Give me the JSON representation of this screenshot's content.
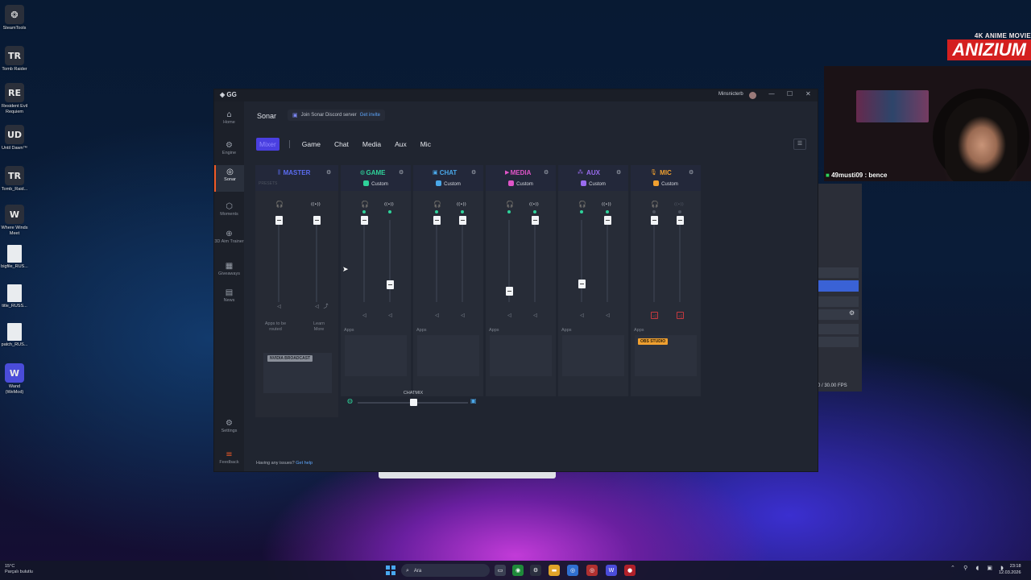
{
  "desktop": {
    "icons": [
      {
        "label": "SteamTools",
        "glyph": "❂"
      },
      {
        "label": "Tomb Raider",
        "glyph": "TR"
      },
      {
        "label": "Resident Evil Requiem",
        "glyph": "RE"
      },
      {
        "label": "Until Dawn™",
        "glyph": "UD"
      },
      {
        "label": "Tomb_Raid...",
        "glyph": "TR"
      },
      {
        "label": "Where Winds Meet",
        "glyph": "W"
      },
      {
        "label": "bigfile_RUS...",
        "glyph": ""
      },
      {
        "label": "title_RUSS...",
        "glyph": ""
      },
      {
        "label": "patch_RUS...",
        "glyph": ""
      },
      {
        "label": "Wand (WeMod)",
        "glyph": "W"
      }
    ]
  },
  "overlay": {
    "brand_top": "4K ANIME MOVIE",
    "brand_logo": "ANIZIUM",
    "chat_user": "49musti09",
    "chat_text": ": bence",
    "obs_fps": "0 / 30.00 FPS"
  },
  "window": {
    "app_logo": "GG",
    "user": "Minsnicterb",
    "controls": {
      "minimize": "—",
      "maximize": "☐",
      "close": "✕"
    }
  },
  "sidebar": {
    "items": [
      {
        "label": "Home",
        "icon": "home-icon",
        "glyph": "⌂"
      },
      {
        "label": "Engine",
        "icon": "engine-icon",
        "glyph": "⚙"
      },
      {
        "label": "Sonar",
        "icon": "sonar-icon",
        "glyph": "◎"
      },
      {
        "label": "Moments",
        "icon": "moments-icon",
        "glyph": "⬡"
      },
      {
        "label": "3D Aim Trainer",
        "icon": "aim-icon",
        "glyph": "⊕"
      },
      {
        "label": "Giveaways",
        "icon": "gift-icon",
        "glyph": "▦"
      },
      {
        "label": "News",
        "icon": "news-icon",
        "glyph": "▤"
      }
    ],
    "settings": "Settings",
    "feedback": "Feedback"
  },
  "header": {
    "title": "Sonar",
    "discord_text": "Join Sonar Discord server",
    "discord_link": "Get invite"
  },
  "tabs": [
    "Mixer",
    "Game",
    "Chat",
    "Media",
    "Aux",
    "Mic"
  ],
  "channels": {
    "master": {
      "name": "MASTER",
      "color": "#5b6cf0",
      "presets": "PRESETS",
      "note_apps": "Apps to be routed",
      "note_learn": "Learn More",
      "app": "NVIDIA BROADCAST",
      "levels": [
        1.0,
        1.0
      ]
    },
    "game": {
      "name": "GAME",
      "color": "#2fd29a",
      "preset": "Custom",
      "apps": "Apps",
      "levels": [
        1.0,
        0.22
      ]
    },
    "chat": {
      "name": "CHAT",
      "color": "#4aa7e8",
      "preset": "Custom",
      "apps": "Apps",
      "levels": [
        1.0,
        1.0
      ]
    },
    "media": {
      "name": "MEDIA",
      "color": "#e055c8",
      "preset": "Custom",
      "apps": "Apps",
      "levels": [
        0.14,
        1.0
      ]
    },
    "aux": {
      "name": "AUX",
      "color": "#9a6cf0",
      "preset": "Custom",
      "apps": "Apps",
      "levels": [
        0.23,
        1.0
      ]
    },
    "mic": {
      "name": "MIC",
      "color": "#f0a030",
      "preset": "Custom",
      "apps": "Apps",
      "app": "OBS STUDIO",
      "levels": [
        1.0,
        1.0
      ]
    }
  },
  "chatmix": {
    "label": "CHATMIX",
    "value": 0.5
  },
  "footer": {
    "text": "Having any issues?",
    "link": "Get help"
  },
  "taskbar": {
    "weather_temp": "15°C",
    "weather_desc": "Parçalı bulutlu",
    "search": "Ara",
    "time": "23:18",
    "date": "12.03.2026"
  }
}
